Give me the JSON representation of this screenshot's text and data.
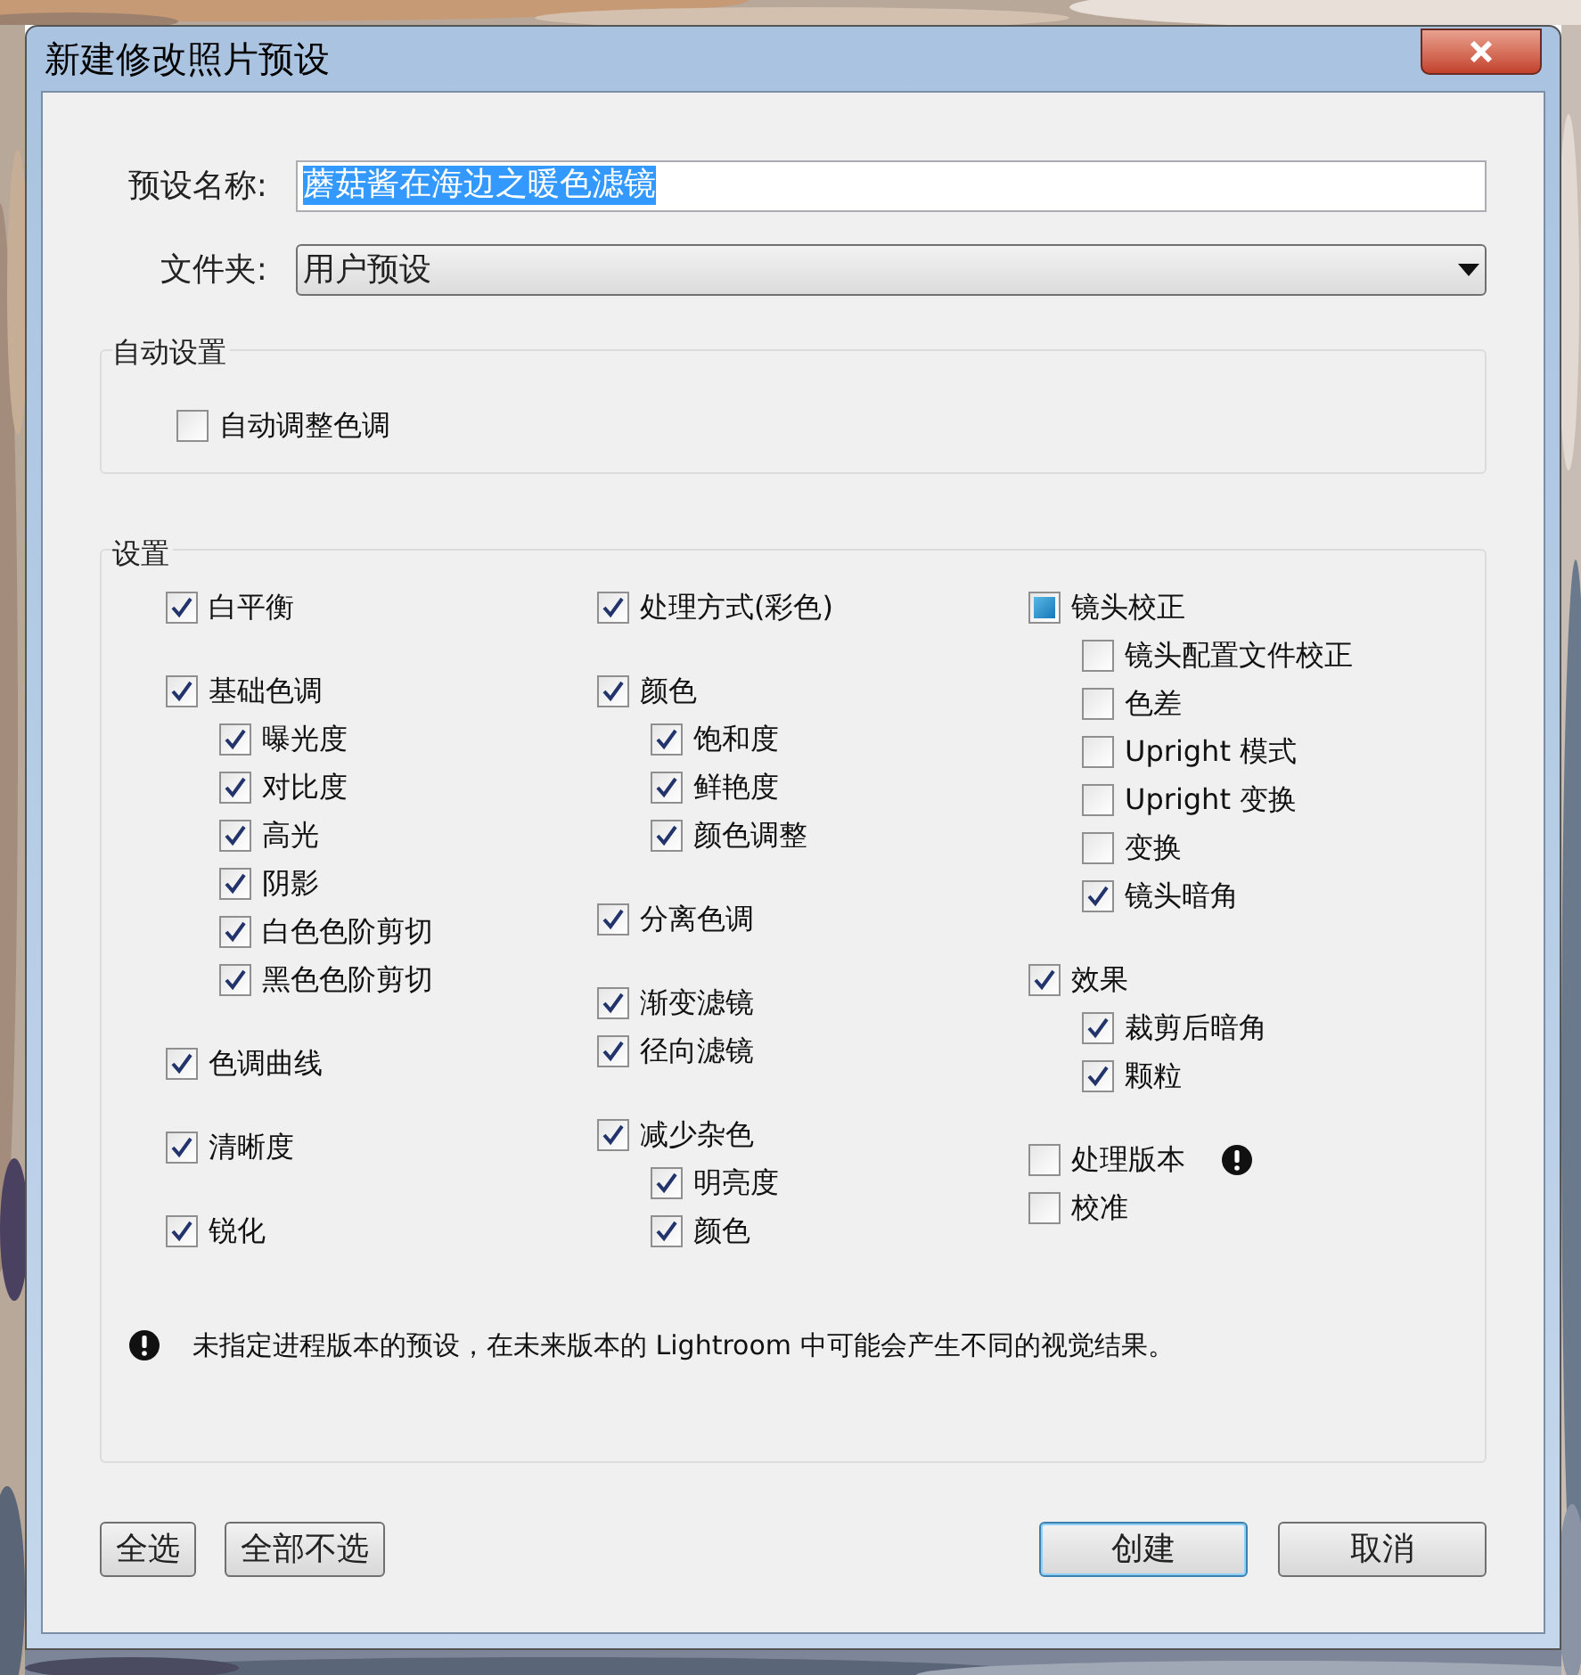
{
  "window": {
    "title": "新建修改照片预设"
  },
  "form": {
    "name_label": "预设名称:",
    "name_value": "蘑菇酱在海边之暖色滤镜",
    "folder_label": "文件夹:",
    "folder_value": "用户预设"
  },
  "auto_settings": {
    "title": "自动设置",
    "items": [
      {
        "label": "自动调整色调",
        "checked": false
      }
    ]
  },
  "settings": {
    "title": "设置",
    "columns": [
      [
        [
          {
            "label": "白平衡",
            "checked": true
          }
        ],
        [
          {
            "label": "基础色调",
            "checked": true,
            "children": [
              {
                "label": "曝光度",
                "checked": true
              },
              {
                "label": "对比度",
                "checked": true
              },
              {
                "label": "高光",
                "checked": true
              },
              {
                "label": "阴影",
                "checked": true
              },
              {
                "label": "白色色阶剪切",
                "checked": true
              },
              {
                "label": "黑色色阶剪切",
                "checked": true
              }
            ]
          }
        ],
        [
          {
            "label": "色调曲线",
            "checked": true
          }
        ],
        [
          {
            "label": "清晰度",
            "checked": true
          }
        ],
        [
          {
            "label": "锐化",
            "checked": true
          }
        ]
      ],
      [
        [
          {
            "label": "处理方式(彩色)",
            "checked": true
          }
        ],
        [
          {
            "label": "颜色",
            "checked": true,
            "children": [
              {
                "label": "饱和度",
                "checked": true
              },
              {
                "label": "鲜艳度",
                "checked": true
              },
              {
                "label": "颜色调整",
                "checked": true
              }
            ]
          }
        ],
        [
          {
            "label": "分离色调",
            "checked": true
          }
        ],
        [
          {
            "label": "渐变滤镜",
            "checked": true
          },
          {
            "label": "径向滤镜",
            "checked": true
          }
        ],
        [
          {
            "label": "减少杂色",
            "checked": true,
            "children": [
              {
                "label": "明亮度",
                "checked": true
              },
              {
                "label": "颜色",
                "checked": true
              }
            ]
          }
        ]
      ],
      [
        [
          {
            "label": "镜头校正",
            "mixed": true,
            "children": [
              {
                "label": "镜头配置文件校正",
                "checked": false
              },
              {
                "label": "色差",
                "checked": false
              },
              {
                "label": "Upright 模式",
                "checked": false
              },
              {
                "label": "Upright 变换",
                "checked": false
              },
              {
                "label": "变换",
                "checked": false
              },
              {
                "label": "镜头暗角",
                "checked": true
              }
            ]
          }
        ],
        [
          {
            "label": "效果",
            "checked": true,
            "children": [
              {
                "label": "裁剪后暗角",
                "checked": true
              },
              {
                "label": "颗粒",
                "checked": true
              }
            ]
          }
        ],
        [
          {
            "label": "处理版本",
            "checked": false,
            "warning": true
          },
          {
            "label": "校准",
            "checked": false
          }
        ]
      ]
    ],
    "note": "未指定进程版本的预设，在未来版本的 Lightroom 中可能会产生不同的视觉结果。"
  },
  "buttons": {
    "left": [
      "全选",
      "全部不选"
    ],
    "right": [
      {
        "label": "创建",
        "default": true
      },
      {
        "label": "取消",
        "default": false
      }
    ]
  }
}
